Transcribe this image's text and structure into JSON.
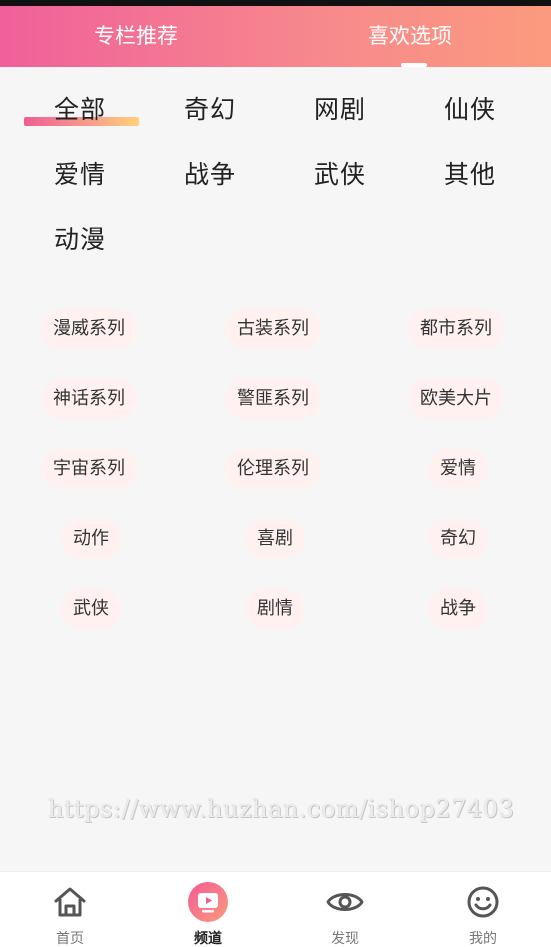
{
  "header": {
    "tabs": [
      {
        "label": "专栏推荐"
      },
      {
        "label": "喜欢选项"
      }
    ],
    "active_tab": 1
  },
  "categories": [
    "全部",
    "奇幻",
    "网剧",
    "仙侠",
    "爱情",
    "战争",
    "武侠",
    "其他",
    "动漫"
  ],
  "active_category": 0,
  "tags": [
    "漫威系列",
    "古装系列",
    "都市系列",
    "神话系列",
    "警匪系列",
    "欧美大片",
    "宇宙系列",
    "伦理系列",
    "爱情",
    "动作",
    "喜剧",
    "奇幻",
    "武侠",
    "剧情",
    "战争"
  ],
  "watermark": "https://www.huzhan.com/ishop27403",
  "bottom_nav": {
    "items": [
      {
        "label": "首页",
        "icon": "home-icon"
      },
      {
        "label": "频道",
        "icon": "channel-tv-icon"
      },
      {
        "label": "发现",
        "icon": "eye-icon"
      },
      {
        "label": "我的",
        "icon": "smiley-icon"
      }
    ],
    "active_index": 1
  },
  "colors": {
    "accent_pink": "#f0609a",
    "accent_orange": "#fb9a7e",
    "tag_bg": "#fff1f0"
  }
}
